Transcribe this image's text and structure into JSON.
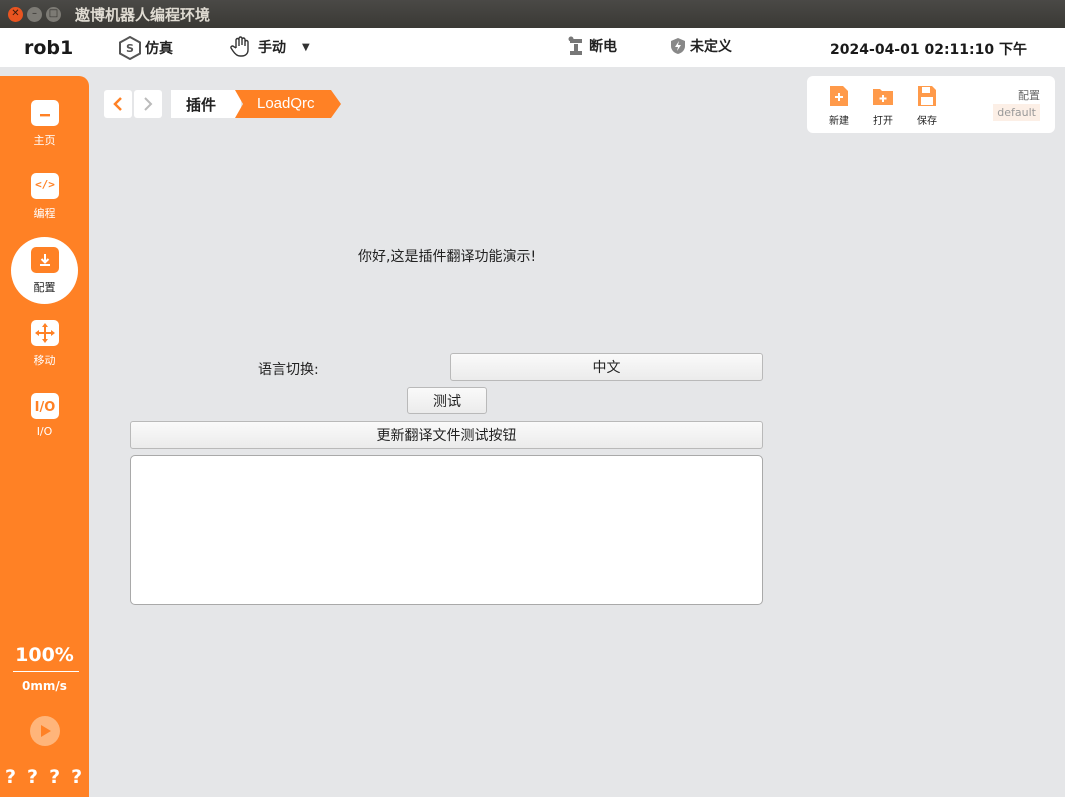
{
  "window": {
    "title": "遨博机器人编程环境"
  },
  "topbar": {
    "robot_name": "rob1",
    "sim_label": "仿真",
    "manual_label": "手动",
    "power_label": "断电",
    "safety_label": "未定义",
    "datetime": "2024-04-01 02:11:10 下午"
  },
  "sidebar": {
    "items": [
      {
        "label": "主页",
        "icon": "home-icon"
      },
      {
        "label": "编程",
        "icon": "code-icon"
      },
      {
        "label": "配置",
        "icon": "config-icon"
      },
      {
        "label": "移动",
        "icon": "move-icon"
      },
      {
        "label": "I/O",
        "icon": "io-icon"
      }
    ],
    "speed_percent": "100%",
    "speed_value": "0mm/s",
    "help_marks": [
      "?",
      "?",
      "?",
      "?"
    ]
  },
  "breadcrumb": {
    "level1": "插件",
    "level2": "LoadQrc"
  },
  "config_panel": {
    "new_label": "新建",
    "open_label": "打开",
    "save_label": "保存",
    "config_label": "配置",
    "config_value": "default"
  },
  "main": {
    "greeting": "你好,这是插件翻译功能演示!",
    "lang_label": "语言切换:",
    "lang_value": "中文",
    "test_button": "测试",
    "update_button": "更新翻译文件测试按钮",
    "output_text": ""
  },
  "colors": {
    "accent": "#ff8125",
    "background": "#e5e6e8"
  }
}
